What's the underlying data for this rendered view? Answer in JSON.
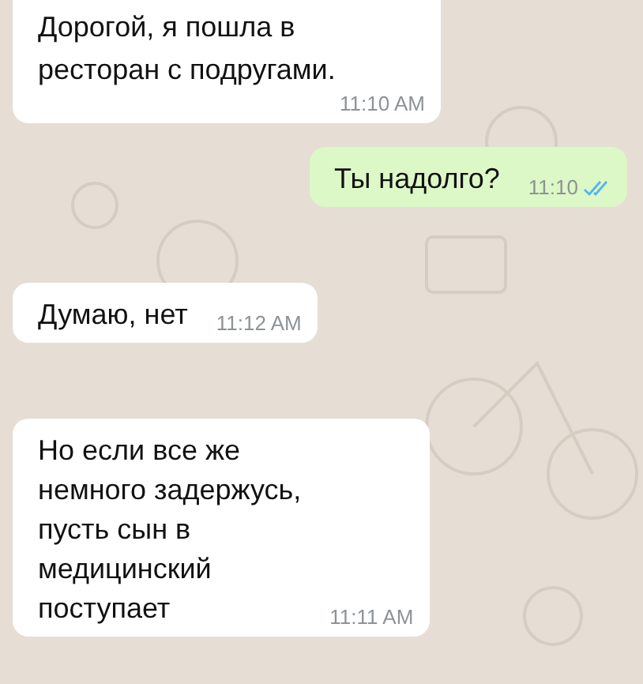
{
  "messages": [
    {
      "kind": "incoming",
      "text": "Дорогой, я пошла в\nресторан с подругами.",
      "time": "11:10 AM"
    },
    {
      "kind": "outgoing",
      "text": "Ты надолго?",
      "time": "11:10",
      "read": true
    },
    {
      "kind": "incoming",
      "text": "Думаю, нет",
      "time": "11:12 AM"
    },
    {
      "kind": "incoming",
      "text": "Но если все же\nнемного задержусь,\nпусть сын в\nмедицинский\nпоступает",
      "time": "11:11 AM"
    }
  ]
}
